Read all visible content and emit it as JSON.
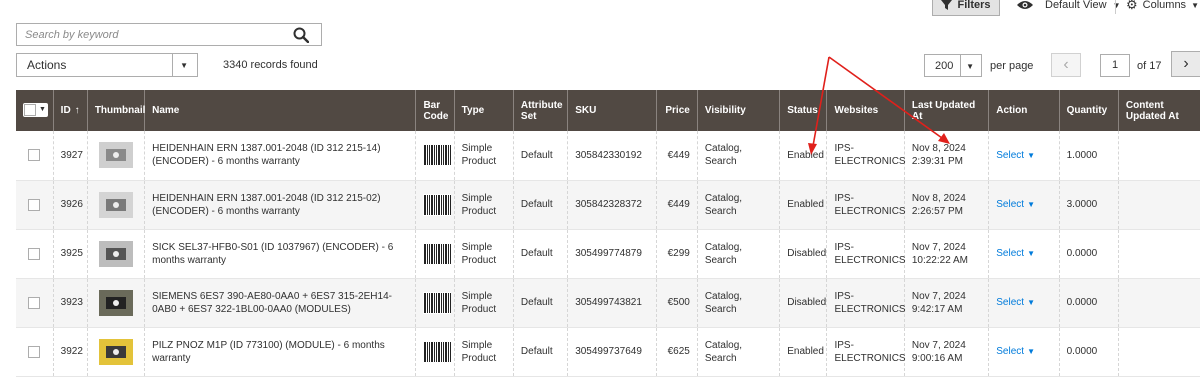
{
  "toolbar": {
    "filters_label": "Filters",
    "view_label": "Default View",
    "columns_label": "Columns"
  },
  "search": {
    "placeholder": "Search by keyword",
    "value": ""
  },
  "actions": {
    "label": "Actions"
  },
  "records_found": "3340 records found",
  "paging": {
    "per_page_value": "200",
    "per_page_label": "per page",
    "current_page": "1",
    "of_pages": "of 17"
  },
  "columns": {
    "id": "ID",
    "sort_indicator": "↑",
    "thumbnail": "Thumbnail",
    "name": "Name",
    "barcode_line1": "Bar",
    "barcode_line2": "Code",
    "type": "Type",
    "attrset_line1": "Attribute",
    "attrset_line2": "Set",
    "sku": "SKU",
    "price": "Price",
    "visibility": "Visibility",
    "status": "Status",
    "websites": "Websites",
    "last_updated": "Last Updated At",
    "action": "Action",
    "quantity": "Quantity",
    "content_line1": "Content",
    "content_line2": "Updated At"
  },
  "rows": [
    {
      "id": "3927",
      "name": "HEIDENHAIN ERN 1387.001-2048 (ID 312 215-14) (ENCODER) - 6 months warranty",
      "type_line1": "Simple",
      "type_line2": "Product",
      "attr_set": "Default",
      "sku": "305842330192",
      "price": "€449",
      "visibility": "Catalog, Search",
      "status": "Enabled",
      "web_line1": "IPS-",
      "web_line2": "ELECTRONICS",
      "date_line1": "Nov 8, 2024",
      "date_line2": "2:39:31 PM",
      "action": "Select",
      "quantity": "1.0000"
    },
    {
      "id": "3926",
      "name": "HEIDENHAIN ERN 1387.001-2048 (ID 312 215-02) (ENCODER) - 6 months warranty",
      "type_line1": "Simple",
      "type_line2": "Product",
      "attr_set": "Default",
      "sku": "305842328372",
      "price": "€449",
      "visibility": "Catalog, Search",
      "status": "Enabled",
      "web_line1": "IPS-",
      "web_line2": "ELECTRONICS",
      "date_line1": "Nov 8, 2024",
      "date_line2": "2:26:57 PM",
      "action": "Select",
      "quantity": "3.0000"
    },
    {
      "id": "3925",
      "name": "SICK SEL37-HFB0-S01 (ID 1037967) (ENCODER) - 6 months warranty",
      "type_line1": "Simple",
      "type_line2": "Product",
      "attr_set": "Default",
      "sku": "305499774879",
      "price": "€299",
      "visibility": "Catalog, Search",
      "status": "Disabled",
      "web_line1": "IPS-",
      "web_line2": "ELECTRONICS",
      "date_line1": "Nov 7, 2024",
      "date_line2": "10:22:22 AM",
      "action": "Select",
      "quantity": "0.0000"
    },
    {
      "id": "3923",
      "name": "SIEMENS 6ES7 390-AE80-0AA0 + 6ES7 315-2EH14-0AB0 + 6ES7 322-1BL00-0AA0 (MODULES)",
      "type_line1": "Simple",
      "type_line2": "Product",
      "attr_set": "Default",
      "sku": "305499743821",
      "price": "€500",
      "visibility": "Catalog, Search",
      "status": "Disabled",
      "web_line1": "IPS-",
      "web_line2": "ELECTRONICS",
      "date_line1": "Nov 7, 2024",
      "date_line2": "9:42:17 AM",
      "action": "Select",
      "quantity": "0.0000"
    },
    {
      "id": "3922",
      "name": "PILZ PNOZ M1P (ID 773100) (MODULE) - 6 months warranty",
      "type_line1": "Simple",
      "type_line2": "Product",
      "attr_set": "Default",
      "sku": "305499737649",
      "price": "€625",
      "visibility": "Catalog, Search",
      "status": "Enabled",
      "web_line1": "IPS-",
      "web_line2": "ELECTRONICS",
      "date_line1": "Nov 7, 2024",
      "date_line2": "9:00:16 AM",
      "action": "Select",
      "quantity": "0.0000"
    }
  ],
  "colors": {
    "header_bg": "#514943",
    "link": "#007bdb",
    "annotation": "#e0201b"
  },
  "icons": {
    "filters": "funnel-icon",
    "view": "eye-icon",
    "columns": "gear-icon",
    "search": "search-icon"
  }
}
